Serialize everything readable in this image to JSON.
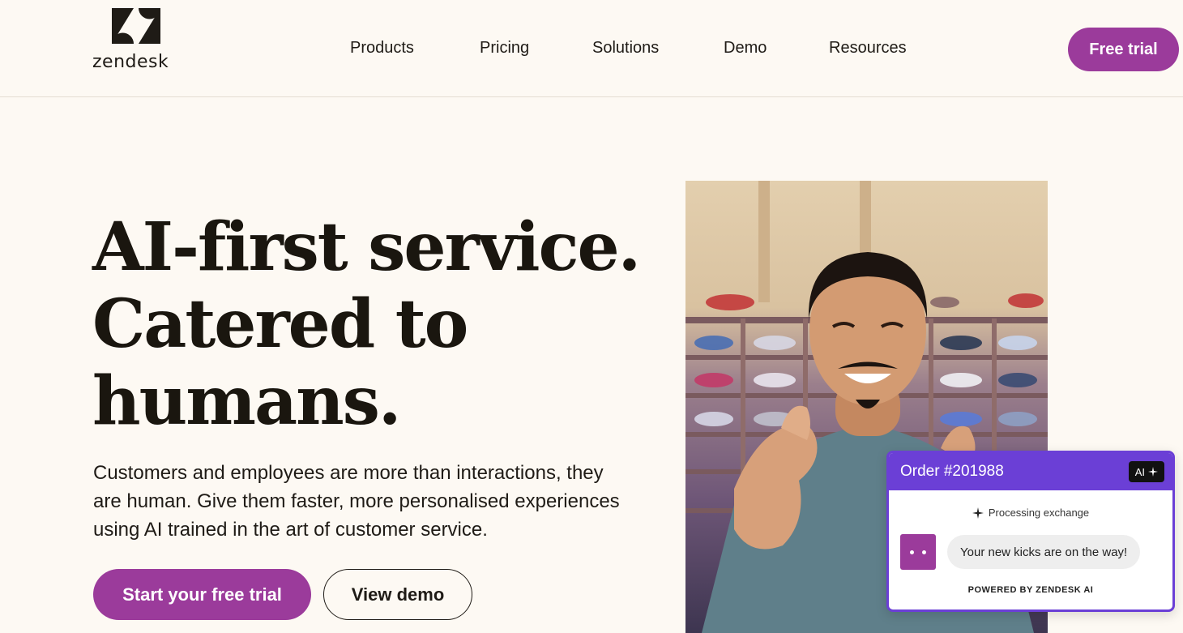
{
  "brand": {
    "name": "zendesk"
  },
  "nav": {
    "items": [
      {
        "label": "Products"
      },
      {
        "label": "Pricing"
      },
      {
        "label": "Solutions"
      },
      {
        "label": "Demo"
      },
      {
        "label": "Resources"
      }
    ],
    "cta_label": "Free trial"
  },
  "hero": {
    "headline": [
      "AI-first service.",
      "Catered to",
      "humans."
    ],
    "subcopy": "Customers and employees are more than interactions, they are human. Give them faster, more personalised experiences using AI trained in the art of customer service.",
    "primary_cta": "Start your free trial",
    "secondary_cta": "View demo"
  },
  "order_card": {
    "title": "Order #201988",
    "badge": "AI",
    "status": "Processing exchange",
    "message": "Your new kicks are on the way!",
    "footer": "POWERED BY ZENDESK AI"
  },
  "colors": {
    "accent": "#9b3b9b",
    "card_header": "#6b3fd6",
    "background": "#fdf9f3"
  },
  "icons": [
    "zendesk-logo-icon",
    "sparkle-icon",
    "bot-face-icon"
  ]
}
